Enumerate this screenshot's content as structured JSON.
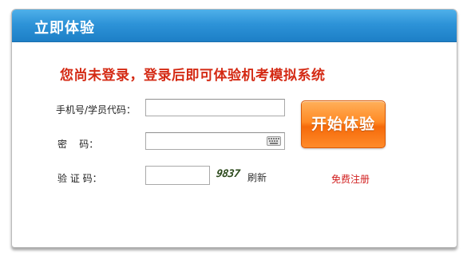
{
  "panel": {
    "title": "立即体验"
  },
  "notice": "您尚未登录，登录后即可体验机考模拟系统",
  "form": {
    "phone_label": "手机号/学员代码：",
    "phone_value": "",
    "password_label": "密    码：",
    "password_value": "",
    "captcha_label": "验 证 码：",
    "captcha_value": "",
    "captcha_image_text": "9837",
    "refresh_label": "刷新"
  },
  "actions": {
    "start_label": "开始体验",
    "register_label": "免费注册"
  },
  "colors": {
    "header_blue": "#2d93d8",
    "notice_red": "#d42a14",
    "button_orange": "#ff8a25",
    "register_red": "#d11e1e"
  },
  "icons": {
    "password_field": "keyboard-icon"
  }
}
